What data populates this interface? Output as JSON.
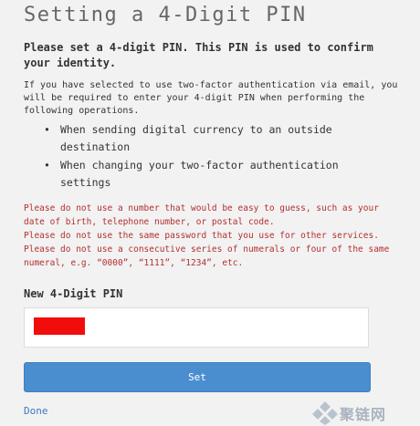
{
  "title": "Setting a 4-Digit PIN",
  "intro": "Please set a 4-digit PIN. This PIN is used to confirm your identity.",
  "description": "If you have selected to use two-factor authentication via email, you will be required to enter your 4-digit PIN when performing the following operations.",
  "operations": [
    "When sending digital currency to an outside destination",
    "When changing your two-factor authentication settings"
  ],
  "warnings": [
    "Please do not use a number that would be easy to guess, such as your date of birth, telephone number, or postal code.",
    "Please do not use the same password that you use for other services.",
    "Please do not use a consecutive series of numerals or four of the same numeral, e.g. “0000”, “1111”, “1234”, etc."
  ],
  "pin_label": "New 4-Digit PIN",
  "pin_value": "",
  "set_button": "Set",
  "done_link": "Done",
  "watermark": "聚链网",
  "colors": {
    "background": "#f2f2f2",
    "warning_text": "#b32f2f",
    "button": "#4b8ed0",
    "link": "#3a7bc0",
    "redaction": "#f20d0d"
  }
}
